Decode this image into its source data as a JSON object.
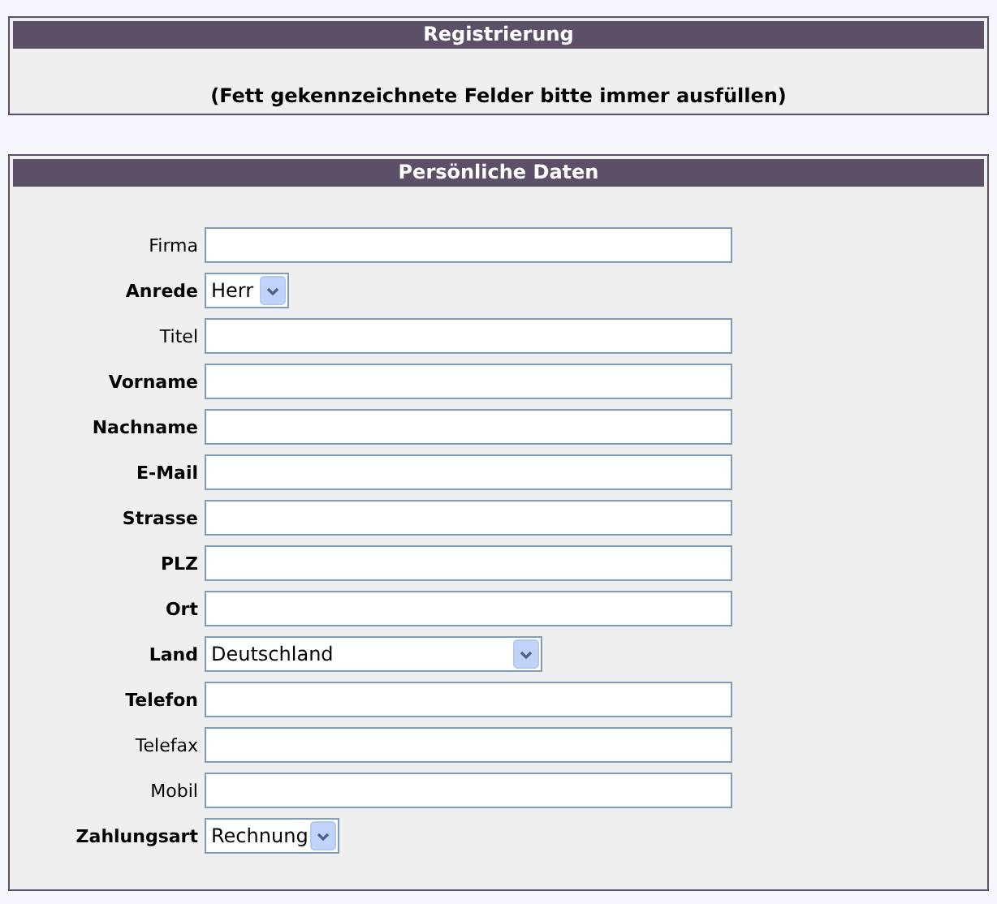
{
  "registration": {
    "title": "Registrierung",
    "note": "(Fett gekennzeichnete Felder bitte immer ausfüllen)"
  },
  "personal": {
    "title": "Persönliche Daten",
    "fields": [
      {
        "label": "Firma",
        "required": false,
        "kind": "text"
      },
      {
        "label": "Anrede",
        "required": true,
        "kind": "select",
        "value": "Herr"
      },
      {
        "label": "Titel",
        "required": false,
        "kind": "text"
      },
      {
        "label": "Vorname",
        "required": true,
        "kind": "text"
      },
      {
        "label": "Nachname",
        "required": true,
        "kind": "text"
      },
      {
        "label": "E-Mail",
        "required": true,
        "kind": "text"
      },
      {
        "label": "Strasse",
        "required": true,
        "kind": "text"
      },
      {
        "label": "PLZ",
        "required": true,
        "kind": "text"
      },
      {
        "label": "Ort",
        "required": true,
        "kind": "text"
      },
      {
        "label": "Land",
        "required": true,
        "kind": "select",
        "value": "Deutschland"
      },
      {
        "label": "Telefon",
        "required": true,
        "kind": "text"
      },
      {
        "label": "Telefax",
        "required": false,
        "kind": "text"
      },
      {
        "label": "Mobil",
        "required": false,
        "kind": "text"
      },
      {
        "label": "Zahlungsart",
        "required": true,
        "kind": "select",
        "value": "Rechnung"
      }
    ]
  }
}
